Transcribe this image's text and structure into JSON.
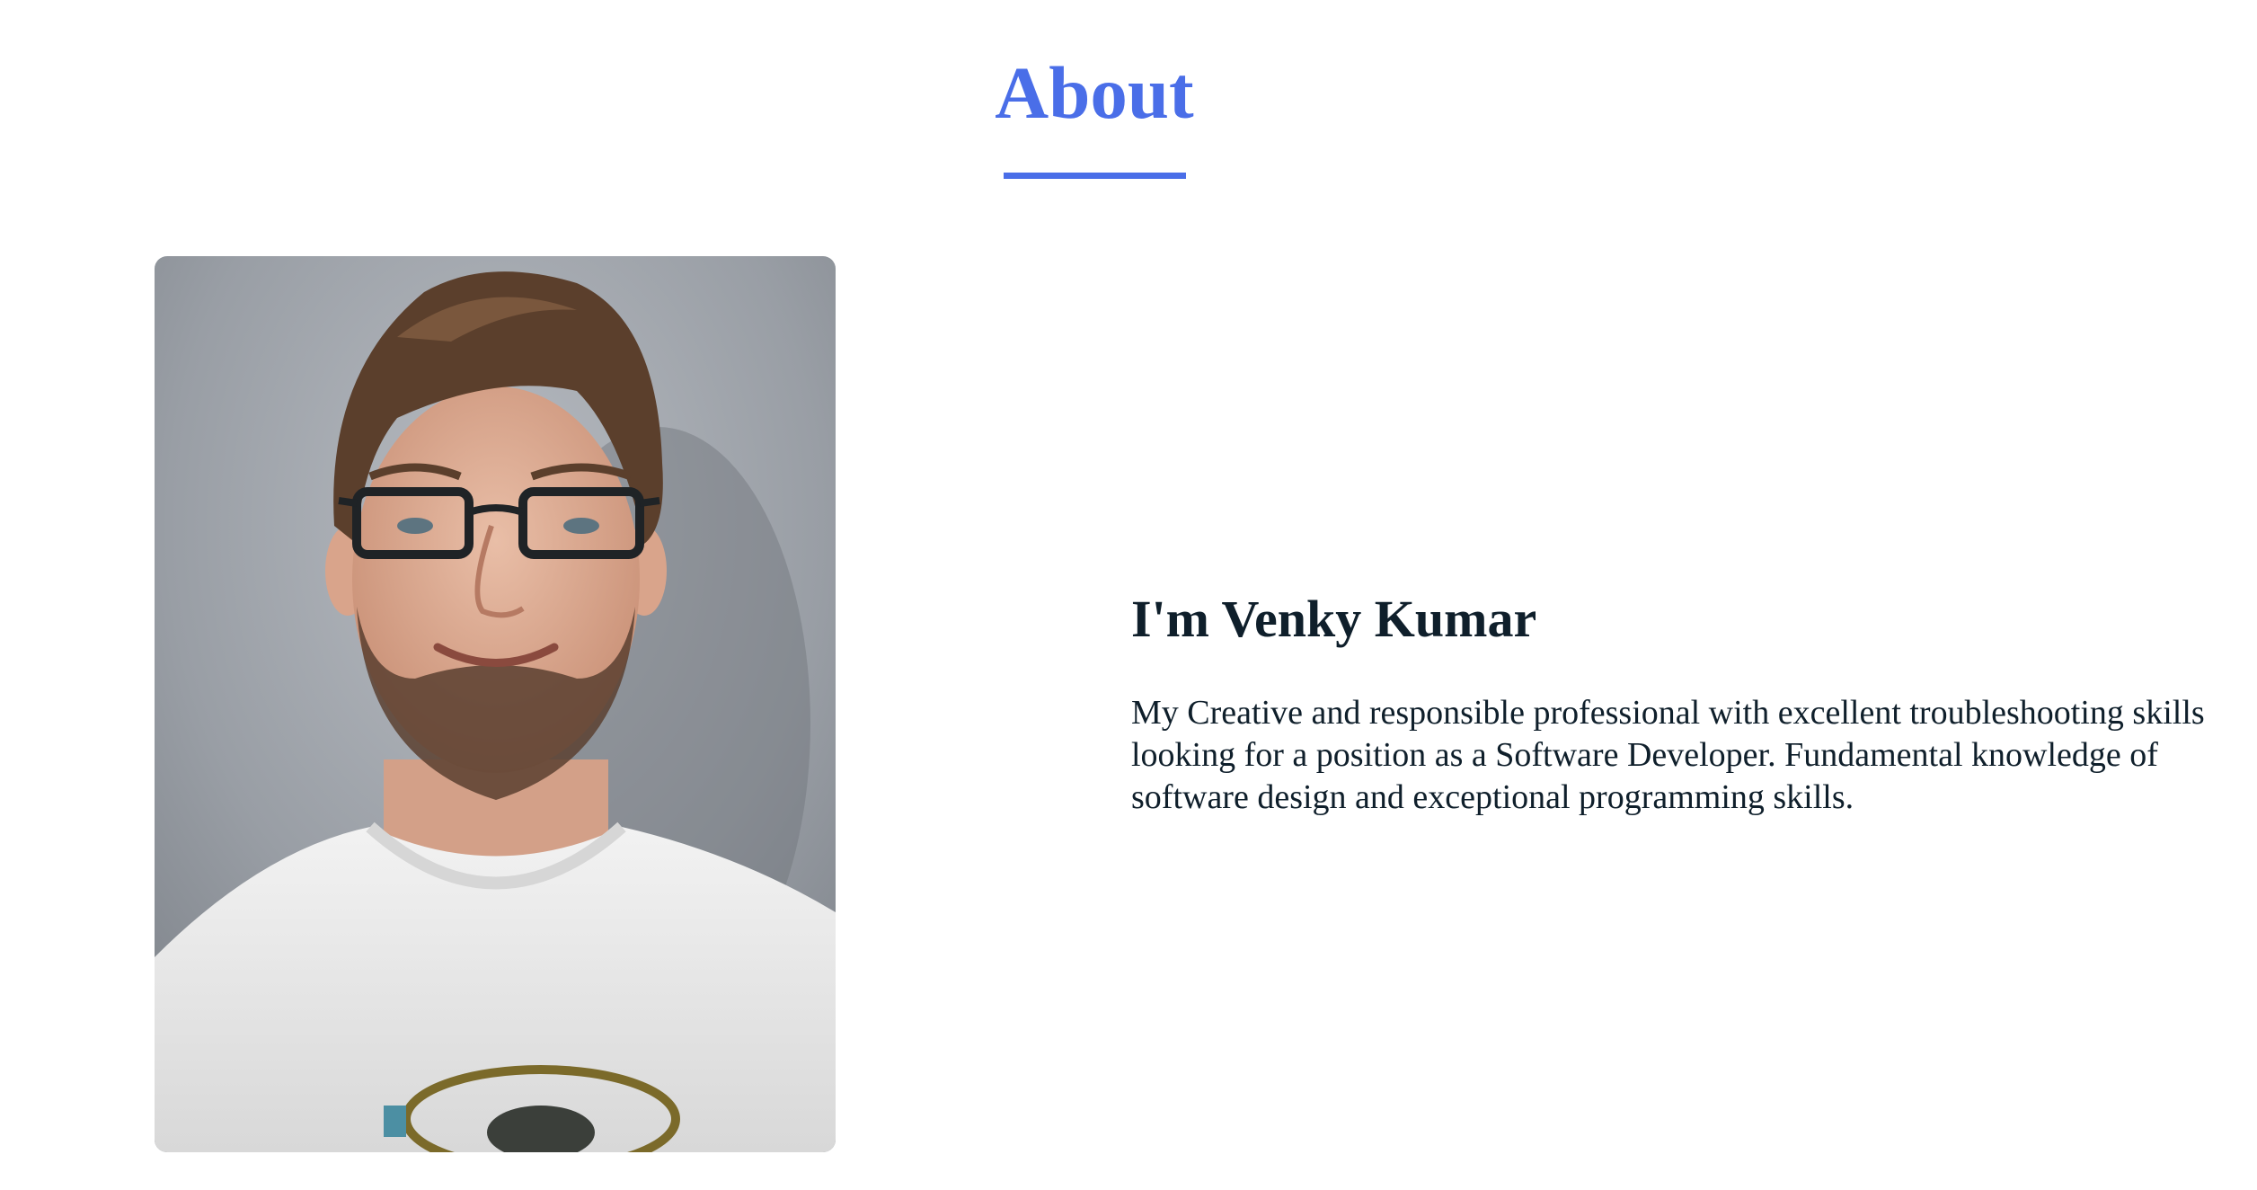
{
  "about": {
    "title": "About",
    "accent_color": "#4a6ee8"
  },
  "profile": {
    "photo_icon": "portrait-photo",
    "name": "I'm Venky Kumar",
    "bio": "My Creative and responsible professional with excellent troubleshooting skills looking for a position as a Software Developer. Fundamental knowledge of software design and exceptional programming skills."
  }
}
